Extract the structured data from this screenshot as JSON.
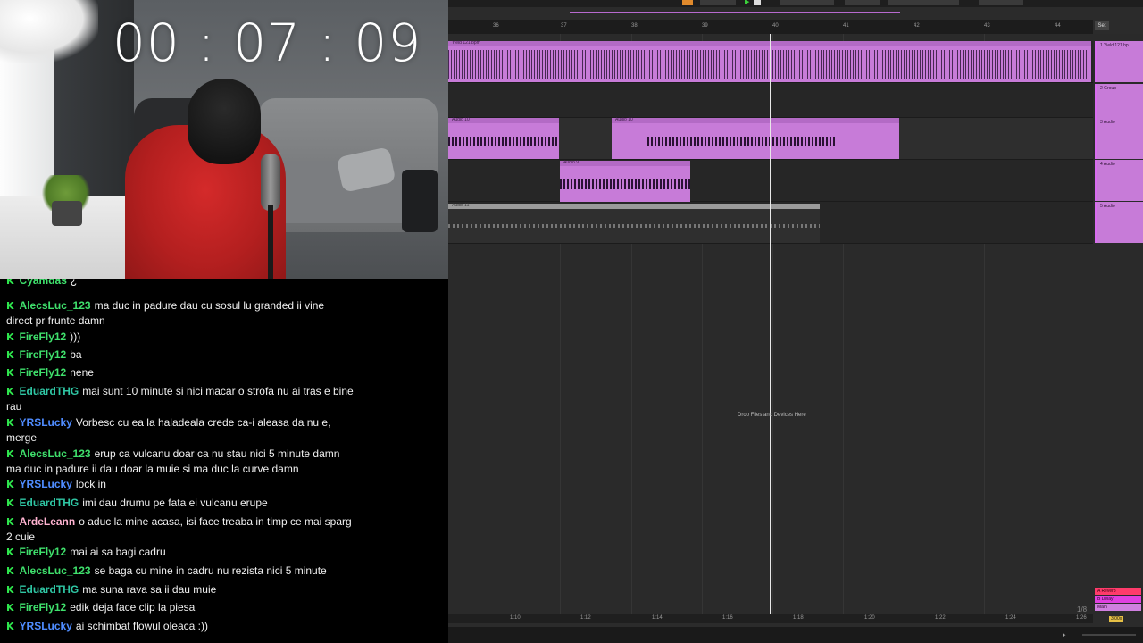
{
  "timer": "00 : 07 : 09",
  "chat": {
    "badge": "K",
    "messages": [
      {
        "user": "Cyamdas",
        "color": "#3fe06c",
        "text": "¿"
      },
      {
        "user": "AlecsLuc_123",
        "color": "#3fe06c",
        "text": "ma duc in padure dau cu sosul lu granded ii vine",
        "text2": "direct pr frunte damn"
      },
      {
        "user": "FireFly12",
        "color": "#3fe06c",
        "text": ")))"
      },
      {
        "user": "FireFly12",
        "color": "#3fe06c",
        "text": "ba"
      },
      {
        "user": "FireFly12",
        "color": "#3fe06c",
        "text": "nene"
      },
      {
        "user": "EduardTHG",
        "color": "#2fc6a4",
        "text": "mai sunt 10 minute si nici macar o strofa nu ai tras e bine",
        "text2": "rau"
      },
      {
        "user": "YRSLucky",
        "color": "#4f8cff",
        "text": "Vorbesc cu ea la haladeala crede ca-i aleasa da nu e,",
        "text2": "merge"
      },
      {
        "user": "AlecsLuc_123",
        "color": "#3fe06c",
        "text": "erup ca vulcanu doar ca nu stau nici 5 minute damn",
        "text2": "ma duc in padure ii dau doar la muie si ma duc la curve damn"
      },
      {
        "user": "YRSLucky",
        "color": "#4f8cff",
        "text": "lock in"
      },
      {
        "user": "EduardTHG",
        "color": "#2fc6a4",
        "text": "imi dau drumu pe fata ei vulcanu erupe"
      },
      {
        "user": "ArdeLeann",
        "color": "#ffb3d1",
        "text": "o aduc la mine acasa, isi face treaba in timp ce mai sparg",
        "text2": "2 cuie"
      },
      {
        "user": "FireFly12",
        "color": "#3fe06c",
        "text": "mai ai sa bagi cadru"
      },
      {
        "user": "AlecsLuc_123",
        "color": "#3fe06c",
        "text": "se baga cu mine in cadru nu rezista nici 5 minute"
      },
      {
        "user": "EduardTHG",
        "color": "#2fc6a4",
        "text": "ma suna rava sa ii dau muie"
      },
      {
        "user": "FireFly12",
        "color": "#3fe06c",
        "text": "edik deja face clip la piesa"
      },
      {
        "user": "YRSLucky",
        "color": "#4f8cff",
        "text": "ai schimbat flowul oleaca :))"
      }
    ]
  },
  "daw": {
    "ruler_ticks": [
      "36",
      "37",
      "38",
      "39",
      "40",
      "41",
      "42",
      "43",
      "44"
    ],
    "set_label": "Set",
    "tracks": [
      {
        "name": "1 Yield 121 bp",
        "clip": "Yield 121 bpm"
      },
      {
        "name": "2 Group"
      },
      {
        "name": "3 Audio",
        "clip": "Audio 10"
      },
      {
        "name": "4 Audio",
        "clip": "Audio 9"
      },
      {
        "name": "5 Audio",
        "clip": "Audio 11"
      }
    ],
    "drop_text": "Drop Files and Devices Here",
    "bottom_ticks": [
      "1:10",
      "1:12",
      "1:14",
      "1:16",
      "1:18",
      "1:20",
      "1:22",
      "1:24",
      "1:26"
    ],
    "returns": [
      "A Reverb",
      "B Delay",
      "Main"
    ],
    "zoom": "1/8",
    "corner": "3.00x",
    "accent": "#c77bd8"
  }
}
